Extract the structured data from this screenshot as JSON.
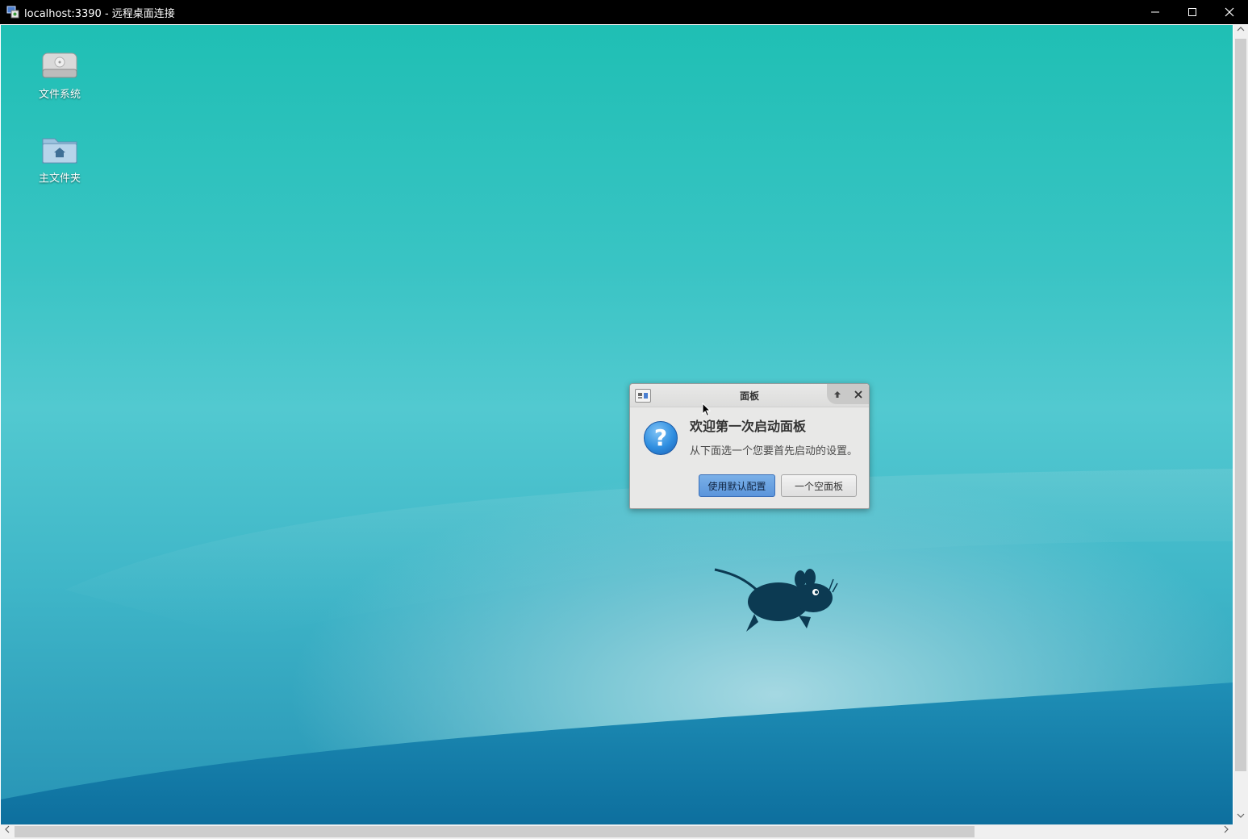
{
  "window": {
    "title": "localhost:3390 - 远程桌面连接",
    "controls": {
      "minimize": "—",
      "maximize": "☐",
      "close": "✕"
    }
  },
  "desktop": {
    "icons": [
      {
        "label": "文件系统",
        "icon": "hard-drive-icon"
      },
      {
        "label": "主文件夹",
        "icon": "home-folder-icon"
      }
    ]
  },
  "dialog": {
    "title": "面板",
    "heading": "欢迎第一次启动面板",
    "message": "从下面选一个您要首先启动的设置。",
    "icon": "question-icon",
    "primary_button": "使用默认配置",
    "secondary_button": "一个空面板"
  },
  "colors": {
    "desktop_top": "#1fbfb4",
    "desktop_bottom": "#2793b5",
    "primary_button": "#5b95db"
  }
}
